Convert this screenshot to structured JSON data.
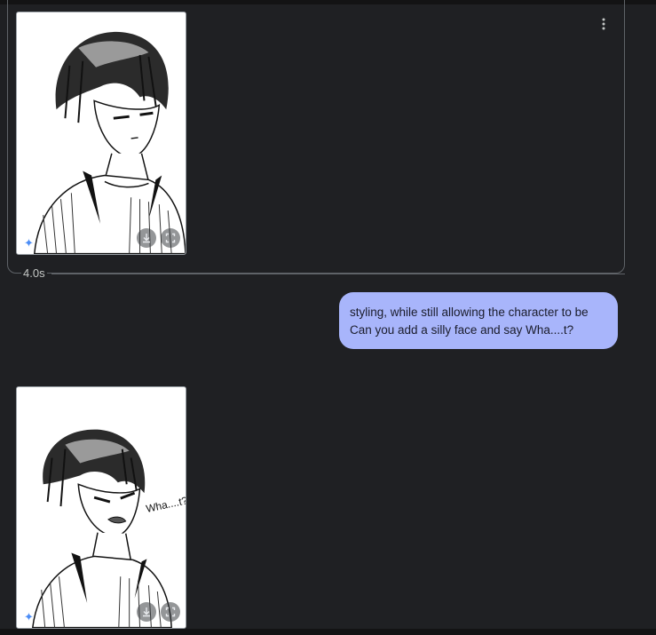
{
  "conversation": {
    "first_response": {
      "image_alt": "Black and white sketch of an anime character with hair over one eye, wearing a striped open shirt",
      "download_icon": "download-icon",
      "fullscreen_icon": "fullscreen-icon",
      "sparkle_icon": "sparkle-icon",
      "more_icon": "more-vert-icon",
      "thinking_time": "4.0s"
    },
    "user_message": {
      "lines": [
        "styling, while still allowing the character to be",
        "Can you add a silly face and say Wha....t?"
      ]
    },
    "second_response": {
      "image_alt": "Black and white sketch of the same character with a grimacing face and handwritten text",
      "image_text": "Wha....t?",
      "download_icon": "download-icon",
      "fullscreen_icon": "fullscreen-icon",
      "sparkle_icon": "sparkle-icon"
    }
  },
  "colors": {
    "background": "#1f2023",
    "user_bubble": "#a8b5fb",
    "sparkle": "#4c8df6"
  }
}
